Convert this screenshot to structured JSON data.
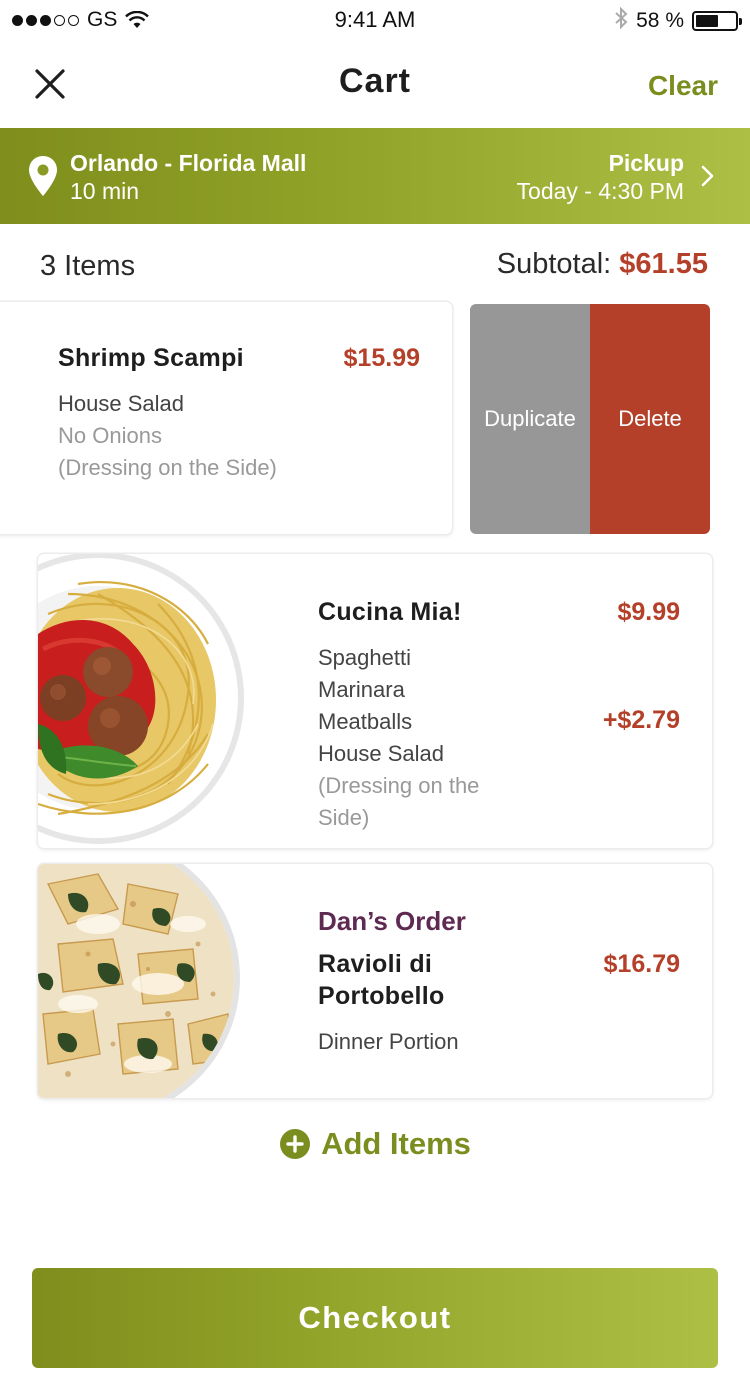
{
  "status_bar": {
    "carrier": "GS",
    "time": "9:41 AM",
    "battery": "58 %",
    "battery_level": 0.58
  },
  "nav": {
    "title": "Cart",
    "clear_label": "Clear",
    "close_icon": "close-icon"
  },
  "location": {
    "name": "Orlando - Florida Mall",
    "travel_time": "10 min",
    "pickup_label": "Pickup",
    "pickup_time": "Today - 4:30 PM"
  },
  "summary": {
    "items_count": "3 Items",
    "subtotal_label": "Subtotal:",
    "subtotal_value": "$61.55"
  },
  "cart_items": [
    {
      "name": "Shrimp Scampi",
      "price": "$15.99",
      "lines": [
        "House Salad"
      ],
      "muted_lines": [
        "No Onions",
        "(Dressing on the Side)"
      ],
      "swipe_actions": {
        "duplicate": "Duplicate",
        "delete": "Delete"
      }
    },
    {
      "name": "Cucina Mia!",
      "price": "$9.99",
      "lines": [
        "Spaghetti",
        "Marinara",
        "Meatballs",
        "House Salad"
      ],
      "extra_price": "+$2.79",
      "muted_lines": [
        "(Dressing on the",
        "Side)"
      ]
    },
    {
      "owner": "Dan’s Order",
      "name_line1": "Ravioli di",
      "name_line2": "Portobello",
      "price": "$16.79",
      "lines": [
        "Dinner Portion"
      ]
    }
  ],
  "add_items_label": "Add Items",
  "checkout_label": "Checkout",
  "colors": {
    "brand_green": "#7a8d1f",
    "price_red": "#b5402a",
    "owner_purple": "#5e2a52",
    "duplicate_gray": "#979797"
  }
}
